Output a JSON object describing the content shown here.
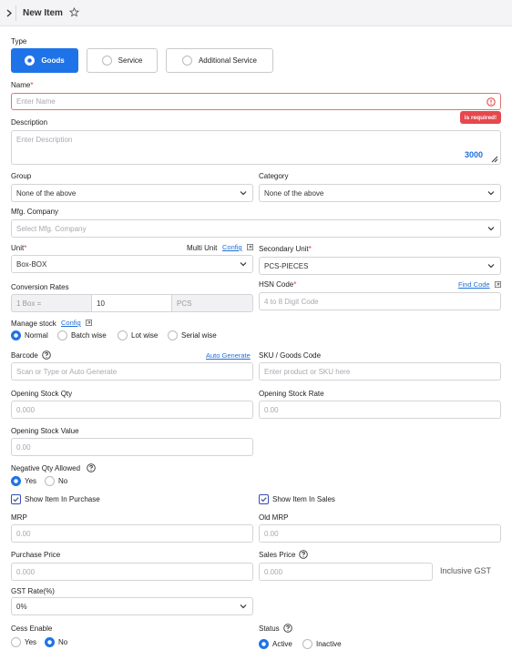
{
  "header": {
    "title": "New Item"
  },
  "type": {
    "label": "Type",
    "options": [
      "Goods",
      "Service",
      "Additional Service"
    ],
    "selected": "Goods"
  },
  "name": {
    "label": "Name",
    "required_mark": "*",
    "placeholder": "Enter Name",
    "error": "is required!"
  },
  "description": {
    "label": "Description",
    "placeholder": "Enter Description",
    "counter": "3000"
  },
  "group": {
    "label": "Group",
    "value": "None of the above"
  },
  "category": {
    "label": "Category",
    "value": "None of the above"
  },
  "mfg": {
    "label": "Mfg. Company",
    "placeholder": "Select Mfg. Company"
  },
  "unit": {
    "label": "Unit",
    "required_mark": "*",
    "multi_unit": "Multi Unit",
    "config": "Config",
    "value": "Box-BOX"
  },
  "secondary_unit": {
    "label": "Secondary Unit",
    "required_mark": "*",
    "value": "PCS-PIECES"
  },
  "conversion": {
    "label": "Conversion Rates",
    "left": "1 Box =",
    "value": "10",
    "right": "PCS"
  },
  "hsn": {
    "label": "HSN Code",
    "required_mark": "*",
    "find": "Find Code",
    "placeholder": "4 to 8 Digit Code"
  },
  "manage_stock": {
    "label": "Manage stock",
    "config": "Config",
    "options": [
      "Normal",
      "Batch wise",
      "Lot wise",
      "Serial wise"
    ],
    "selected": "Normal"
  },
  "barcode": {
    "label": "Barcode",
    "auto": "Auto Generate",
    "placeholder": "Scan or Type or Auto Generate"
  },
  "sku": {
    "label": "SKU / Goods Code",
    "placeholder": "Enter product or SKU here"
  },
  "opening_qty": {
    "label": "Opening Stock Qty",
    "placeholder": "0.000"
  },
  "opening_rate": {
    "label": "Opening Stock Rate",
    "placeholder": "0.00"
  },
  "opening_value": {
    "label": "Opening Stock Value",
    "placeholder": "0.00"
  },
  "negative_qty": {
    "label": "Negative Qty Allowed",
    "options": [
      "Yes",
      "No"
    ],
    "selected": "Yes"
  },
  "show_purchase": {
    "label": "Show Item In Purchase",
    "checked": true
  },
  "show_sales": {
    "label": "Show Item In Sales",
    "checked": true
  },
  "mrp": {
    "label": "MRP",
    "placeholder": "0.00"
  },
  "old_mrp": {
    "label": "Old MRP",
    "placeholder": "0.00"
  },
  "purchase_price": {
    "label": "Purchase Price",
    "placeholder": "0.000"
  },
  "sales_price": {
    "label": "Sales Price",
    "placeholder": "0.000",
    "suffix": "Inclusive GST"
  },
  "gst": {
    "label": "GST Rate(%)",
    "value": "0%"
  },
  "cess": {
    "label": "Cess Enable",
    "options": [
      "Yes",
      "No"
    ],
    "selected": "No"
  },
  "status": {
    "label": "Status",
    "options": [
      "Active",
      "Inactive"
    ],
    "selected": "Active"
  },
  "colors": {
    "primary": "#1e73e8",
    "error": "#e53935",
    "link": "#1e6fd9"
  },
  "icons": [
    "chevron-right-icon",
    "star-icon",
    "error-circle-icon",
    "resize-icon",
    "chevron-down-icon",
    "help-icon",
    "external-link-icon",
    "check-icon"
  ]
}
